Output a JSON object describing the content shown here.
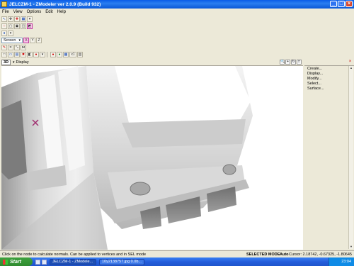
{
  "window": {
    "title": "JELCZM-1 - ZModeler ver 2.0.9 (Build 932)",
    "min_glyph": "_",
    "max_glyph": "□",
    "close_glyph": "×"
  },
  "menu": [
    "File",
    "View",
    "Options",
    "Edit",
    "Help"
  ],
  "toolbar": {
    "screen_dropdown": "Screen",
    "screen_arrow": "▾",
    "row_tools_4_glyphs": [
      "X",
      "Y",
      "Z"
    ],
    "row_tools_6_text": "x1"
  },
  "viewport": {
    "label": "3D",
    "view_name": "Display",
    "icons": [
      "🔍",
      "+",
      "↻",
      "□"
    ]
  },
  "right_panel": {
    "items": [
      "Create...",
      "Display...",
      "Modify...",
      "Select...",
      "Surface..."
    ],
    "close_glyph": "×"
  },
  "status": {
    "message": "Click on the node to calculate normals. Can be applied to vertices and in SEL mode",
    "mode": "SELECTED MODE",
    "auto": "Auto",
    "cursor": "Cursor: 2.18742, -0.67325, -1.80645"
  },
  "taskbar": {
    "start": "Start",
    "tasks": [
      "JELCZM-1 - ZModele...",
      "10y2138757.jpg 0.0b..."
    ],
    "clock": "23:04"
  },
  "colors": {
    "title_blue": "#0a5ce8",
    "xp_beige": "#ece9d8",
    "taskbar_blue": "#245edb",
    "start_green": "#3fa23f"
  }
}
